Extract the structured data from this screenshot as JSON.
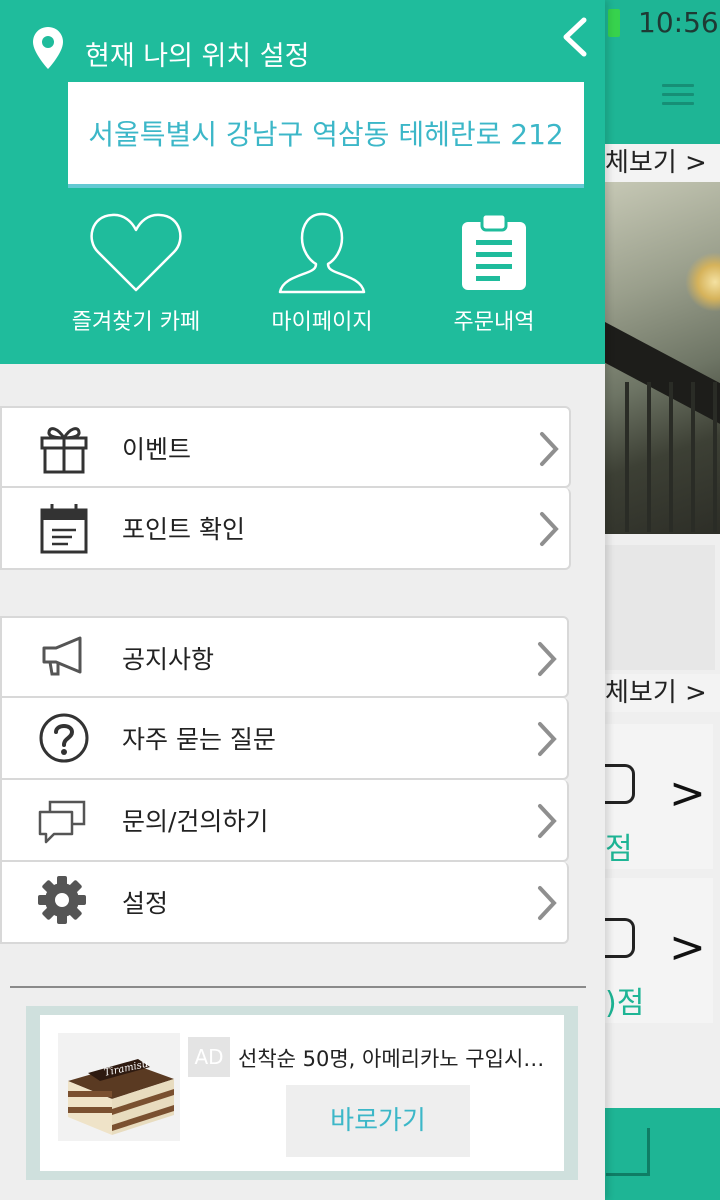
{
  "status_bar": {
    "time": "10:56"
  },
  "background": {
    "see_all_1": "체보기 >",
    "see_all_2": "체보기 >",
    "item_1_score": "점",
    "item_2_score": ")점",
    "chevron": ">"
  },
  "drawer": {
    "location_title": "현재 나의 위치 설정",
    "address": "서울특별시 강남구 역삼동 테헤란로 212",
    "quick_links": [
      {
        "label": "즐겨찾기 카페",
        "icon": "heart-icon"
      },
      {
        "label": "마이페이지",
        "icon": "user-icon"
      },
      {
        "label": "주문내역",
        "icon": "clipboard-icon"
      }
    ],
    "menu_primary": [
      {
        "label": "이벤트",
        "icon": "gift-icon"
      },
      {
        "label": "포인트 확인",
        "icon": "calendar-icon"
      }
    ],
    "menu_secondary": [
      {
        "label": "공지사항",
        "icon": "megaphone-icon"
      },
      {
        "label": "자주 묻는 질문",
        "icon": "question-icon"
      },
      {
        "label": "문의/건의하기",
        "icon": "chat-icon"
      },
      {
        "label": "설정",
        "icon": "gear-icon"
      }
    ],
    "ad": {
      "badge": "AD",
      "text": "선착순 50명, 아메리카노 구입시 …",
      "button": "바로가기",
      "image_caption": "Tiramisu"
    }
  },
  "colors": {
    "primary": "#1fbc9c",
    "accent_text": "#3cb7c8",
    "menu_bg": "#eeeeee"
  }
}
